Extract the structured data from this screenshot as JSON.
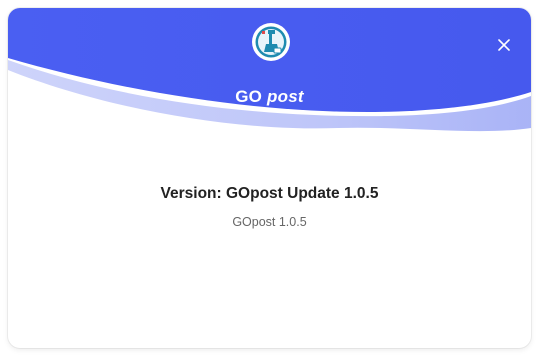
{
  "dialog": {
    "brand_prefix": "GO",
    "brand_suffix": "post",
    "version_title": "Version: GOpost Update 1.0.5",
    "version_subtitle": "GOpost 1.0.5",
    "close_icon": "close-icon",
    "logo_icon": "gopost-logo-icon"
  },
  "colors": {
    "header_blue": "#4a5cf0",
    "header_wave_light": "#a9b3f7",
    "logo_teal": "#1f8bb0",
    "title_text": "#222222",
    "subtitle_text": "#666666"
  }
}
